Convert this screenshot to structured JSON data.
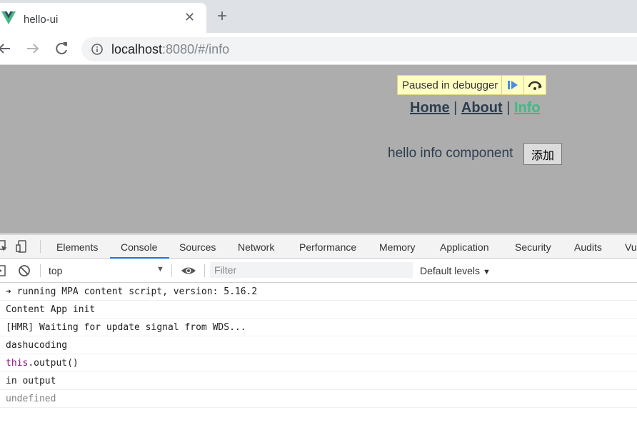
{
  "browser": {
    "tab_title": "hello-ui",
    "close_glyph": "✕",
    "new_tab_glyph": "+",
    "url_host": "localhost",
    "url_rest": ":8080/#/info"
  },
  "page": {
    "paused_text": "Paused in debugger",
    "nav": {
      "home": "Home",
      "sep1": " | ",
      "about": "About",
      "sep2": " | ",
      "info": "Info"
    },
    "hello_text": "hello info component",
    "add_button": "添加",
    "colors": {
      "background": "#adadad",
      "text": "#2c3e50",
      "active_link": "#42b983"
    }
  },
  "devtools": {
    "tabs": [
      "Elements",
      "Console",
      "Sources",
      "Network",
      "Performance",
      "Memory",
      "Application",
      "Security",
      "Audits",
      "Vu"
    ],
    "active_tab": "Console",
    "context": "top",
    "filter_placeholder": "Filter",
    "levels_label": "Default levels",
    "levels_arrow": "▼",
    "context_arrow": "▼",
    "console_lines": [
      {
        "prefix": "➔ ",
        "text": "running MPA content script, version: 5.16.2"
      },
      {
        "text": "Content App init"
      },
      {
        "text": "[HMR] Waiting for update signal from WDS..."
      },
      {
        "text": "dashucoding"
      },
      {
        "kw": "this",
        "text": ".output()"
      },
      {
        "text": "in output"
      },
      {
        "text": "undefined"
      }
    ]
  }
}
